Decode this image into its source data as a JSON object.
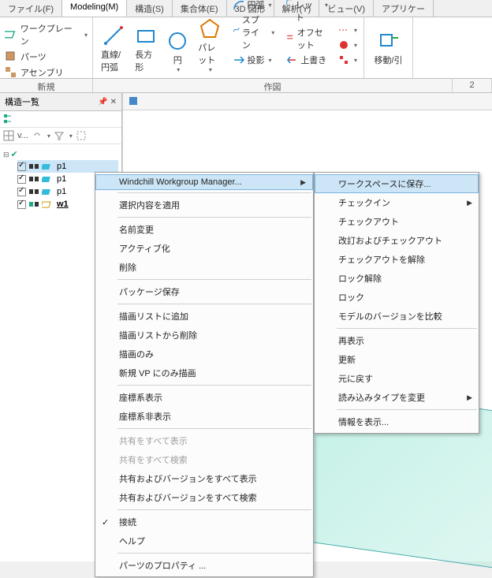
{
  "tabs": {
    "file": "ファイル(F)",
    "modeling": "Modeling(M)",
    "structure": "構造(S)",
    "assembly": "集合体(E)",
    "3d": "3D 図形",
    "analysis": "解析(Y)",
    "view": "ビュー(V)",
    "app": "アプリケー"
  },
  "ribbon": {
    "leftItems": {
      "workplane": "ワークプレーン",
      "parts": "パーツ",
      "assembly": "アセンブリ"
    },
    "draw": {
      "lineCircle": "直線/円弧",
      "rectangle": "長方形",
      "circle": "円",
      "palette": "パレット",
      "arc": "円弧",
      "spline": "スプライン",
      "project": "投影"
    },
    "modify": {
      "fillet": "フィレット",
      "offset": "オフセット",
      "overwrite": "上書き"
    },
    "moveSection": "移動/引"
  },
  "groupTitles": {
    "new": "新規",
    "sketch": "作図",
    "two": "2"
  },
  "panel": {
    "title": "構造一覧",
    "tbDD": "v...",
    "tree": {
      "items": [
        {
          "label": "p1"
        },
        {
          "label": "p1"
        },
        {
          "label": "p1"
        },
        {
          "label": "w1"
        }
      ]
    }
  },
  "menu1": {
    "wwm": "Windchill Workgroup Manager...",
    "applySel": "選択内容を適用",
    "rename": "名前変更",
    "activate": "アクティブ化",
    "delete": "削除",
    "pkgSave": "パッケージ保存",
    "addDraw": "描画リストに追加",
    "delDraw": "描画リストから削除",
    "drawOnly": "描画のみ",
    "newVP": "新規 VP にのみ描画",
    "showCS": "座標系表示",
    "hideCS": "座標系非表示",
    "showAllShare": "共有をすべて表示",
    "findAllShare": "共有をすべて検索",
    "showAllVer": "共有およびバージョンをすべて表示",
    "findAllVer": "共有およびバージョンをすべて検索",
    "connect": "接続",
    "help": "ヘルプ",
    "partProps": "パーツのプロパティ ..."
  },
  "menu2": {
    "saveWS": "ワークスペースに保存...",
    "checkin": "チェックイン",
    "checkout": "チェックアウト",
    "revCheckout": "改訂およびチェックアウト",
    "undoCheckout": "チェックアウトを解除",
    "unlock": "ロック解除",
    "lock": "ロック",
    "compareVer": "モデルのバージョンを比較",
    "redisplay": "再表示",
    "refresh": "更新",
    "revert": "元に戻す",
    "changeLoad": "読み込みタイプを変更",
    "showInfo": "情報を表示..."
  }
}
